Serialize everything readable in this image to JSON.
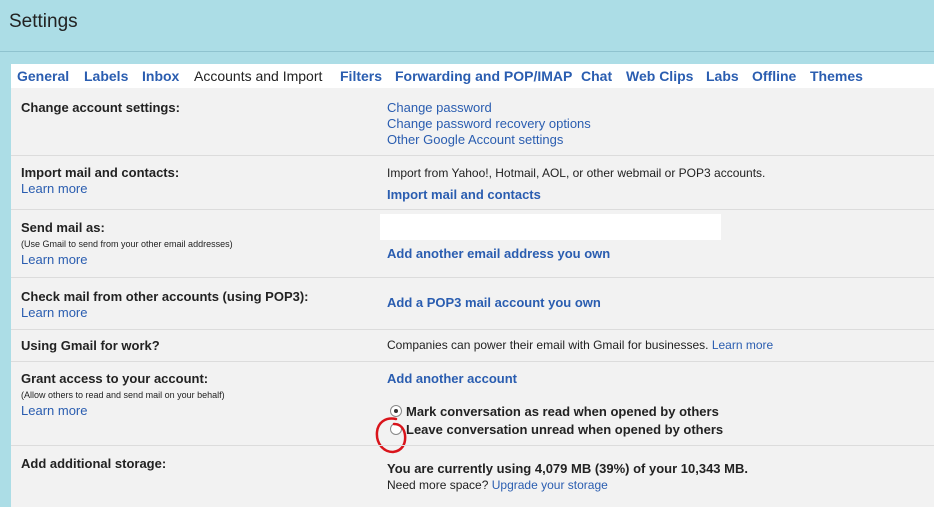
{
  "header": {
    "title": "Settings"
  },
  "tabs": [
    {
      "label": "General"
    },
    {
      "label": "Labels"
    },
    {
      "label": "Inbox"
    },
    {
      "label": "Accounts and Import",
      "active": true
    },
    {
      "label": "Filters"
    },
    {
      "label": "Forwarding and POP/IMAP"
    },
    {
      "label": "Chat"
    },
    {
      "label": "Web Clips"
    },
    {
      "label": "Labs"
    },
    {
      "label": "Offline"
    },
    {
      "label": "Themes"
    }
  ],
  "sections": {
    "change_account": {
      "label": "Change account settings:",
      "links": [
        "Change password",
        "Change password recovery options",
        "Other Google Account settings"
      ]
    },
    "import": {
      "label": "Import mail and contacts:",
      "learn_more": "Learn more",
      "description": "Import from Yahoo!, Hotmail, AOL, or other webmail or POP3 accounts.",
      "action": "Import mail and contacts"
    },
    "send_as": {
      "label": "Send mail as:",
      "note": "(Use Gmail to send from your other email addresses)",
      "learn_more": "Learn more",
      "action": "Add another email address you own"
    },
    "check_mail": {
      "label": "Check mail from other accounts (using POP3):",
      "learn_more": "Learn more",
      "action": "Add a POP3 mail account you own"
    },
    "gmail_work": {
      "label": "Using Gmail for work?",
      "description": "Companies can power their email with Gmail for businesses.",
      "learn_more": "Learn more"
    },
    "grant_access": {
      "label": "Grant access to your account:",
      "note": "(Allow others to read and send mail on your behalf)",
      "learn_more": "Learn more",
      "action": "Add another account",
      "options": [
        {
          "label": "Mark conversation as read when opened by others",
          "selected": true
        },
        {
          "label": "Leave conversation unread when opened by others",
          "selected": false
        }
      ]
    },
    "storage": {
      "label": "Add additional storage:",
      "usage": "You are currently using 4,079 MB (39%) of your 10,343 MB.",
      "need_more": "Need more space?",
      "upgrade": "Upgrade your storage"
    }
  },
  "colors": {
    "header_bg": "#acdde6",
    "link": "#2a5db0",
    "panel_bg": "#f2f2f2",
    "annotation": "#d9141b"
  }
}
